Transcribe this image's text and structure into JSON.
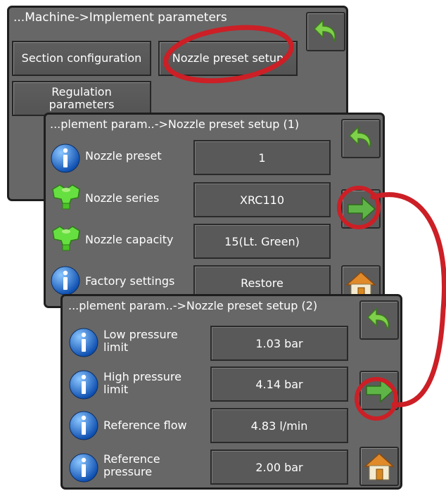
{
  "screen1": {
    "title": "...Machine->Implement parameters",
    "buttons": {
      "section_configuration": "Section configuration",
      "nozzle_preset_setup": "Nozzle preset setup",
      "regulation_parameters": "Regulation parameters"
    }
  },
  "screen2": {
    "title": "...plement param..->Nozzle preset setup (1)",
    "rows": [
      {
        "label": "Nozzle preset",
        "value": "1",
        "icon": "info-icon"
      },
      {
        "label": "Nozzle series",
        "value": "XRC110",
        "icon": "nozzle-icon"
      },
      {
        "label": "Nozzle capacity",
        "value": "15(Lt. Green)",
        "icon": "nozzle-icon"
      },
      {
        "label": "Factory settings",
        "value": "Restore",
        "icon": "info-icon"
      }
    ]
  },
  "screen3": {
    "title": "...plement param..->Nozzle preset setup (2)",
    "rows": [
      {
        "label": "Low pressure limit",
        "value": "1.03 bar",
        "icon": "info-icon"
      },
      {
        "label": "High pressure limit",
        "value": "4.14 bar",
        "icon": "info-icon"
      },
      {
        "label": "Reference flow",
        "value": "4.83 l/min",
        "icon": "info-icon"
      },
      {
        "label": "Reference pressure",
        "value": "2.00 bar",
        "icon": "info-icon"
      }
    ]
  },
  "icons": {
    "back": "back-arrow-icon",
    "next": "next-arrow-icon",
    "home": "home-icon"
  },
  "colors": {
    "panel": "#676767",
    "highlight": "#cc1f26",
    "next_arrow": "#5fb447",
    "back_arrow": "#7fd04a",
    "info_blue": "#1f6fd1",
    "nozzle_green": "#66e040"
  }
}
